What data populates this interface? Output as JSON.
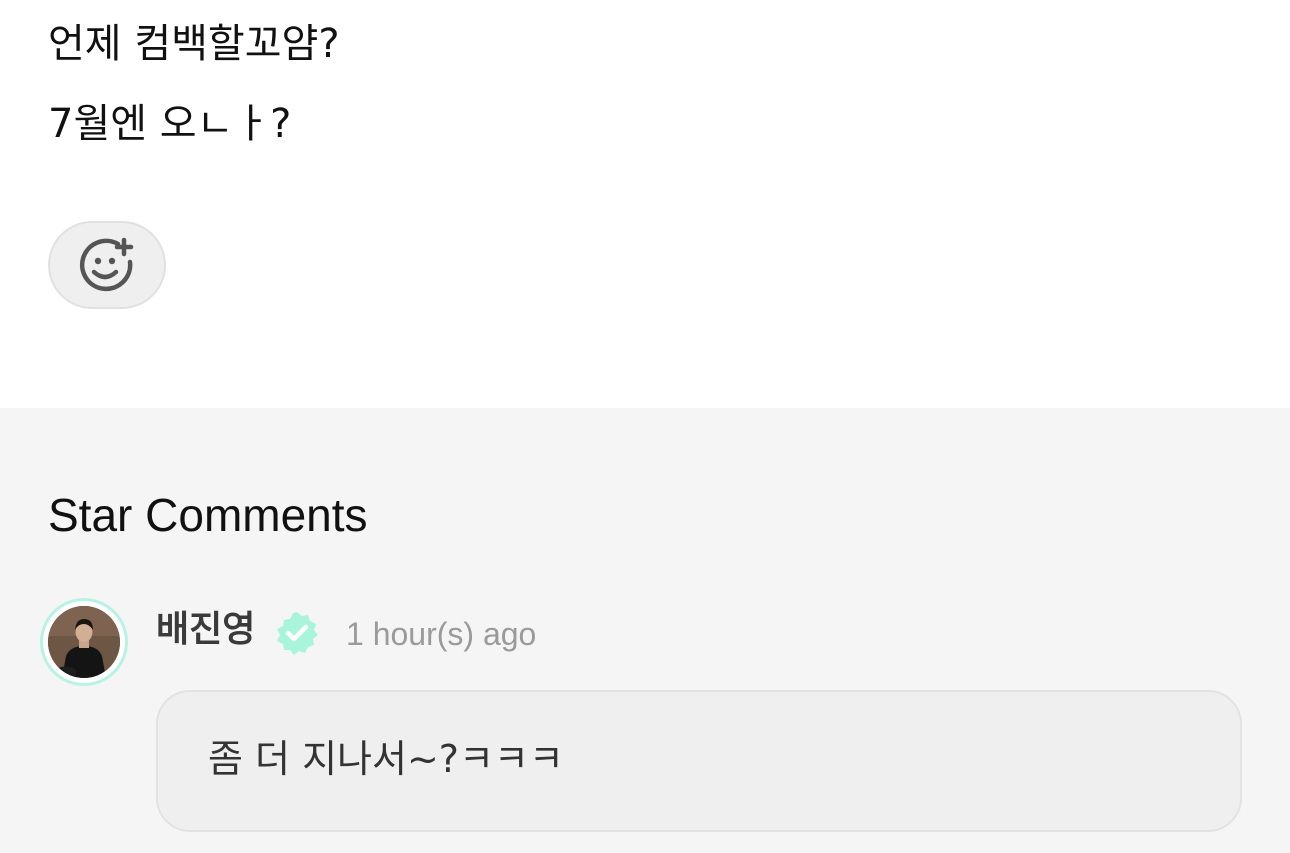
{
  "post": {
    "lines": [
      "언제 컴백할꼬얌?",
      "7월엔 오ㄴㅏ?"
    ]
  },
  "reaction": {
    "icon": "add-reaction-icon"
  },
  "comments": {
    "section_title": "Star Comments",
    "items": [
      {
        "author": "배진영",
        "verified_icon": "verified-badge-icon",
        "verified_color": "#a8f5dc",
        "timestamp": "1 hour(s) ago",
        "text": "좀 더 지나서~?ㅋㅋㅋ"
      }
    ]
  }
}
